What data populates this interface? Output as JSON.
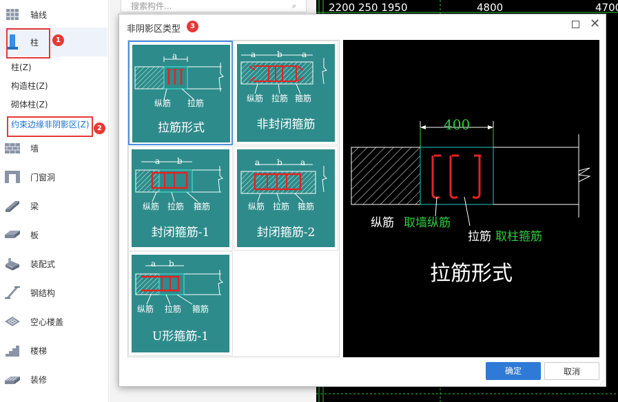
{
  "sidebar": {
    "categories": [
      {
        "label": "轴线",
        "icon": "axis-grid-icon"
      },
      {
        "label": "柱",
        "icon": "column-icon"
      },
      {
        "label": "墙",
        "icon": "wall-icon"
      },
      {
        "label": "门窗洞",
        "icon": "door-window-icon"
      },
      {
        "label": "梁",
        "icon": "beam-icon"
      },
      {
        "label": "板",
        "icon": "slab-icon"
      },
      {
        "label": "装配式",
        "icon": "prefab-icon"
      },
      {
        "label": "钢结构",
        "icon": "steel-structure-icon"
      },
      {
        "label": "空心楼盖",
        "icon": "hollow-floor-icon"
      },
      {
        "label": "楼梯",
        "icon": "stair-icon"
      },
      {
        "label": "装修",
        "icon": "decoration-icon"
      }
    ],
    "column_subitems": [
      "柱(Z)",
      "构造柱(Z)",
      "砌体柱(Z)",
      "约束边缘非阴影区(Z)"
    ],
    "badges": [
      "1",
      "2",
      "3"
    ]
  },
  "search": {
    "placeholder": "搜索构件..."
  },
  "cad_header": {
    "left": "2200  250 1950",
    "mid": "4800",
    "right": "4700"
  },
  "dialog": {
    "title": "非阴影区类型",
    "ok_label": "确定",
    "cancel_label": "取消",
    "types": [
      {
        "name": "拉筋形式",
        "labels": [
          "纵筋",
          "拉筋"
        ],
        "dims": [
          "a"
        ]
      },
      {
        "name": "非封闭箍筋",
        "labels": [
          "纵筋",
          "拉筋",
          "箍筋"
        ],
        "dims": [
          "a",
          "b",
          "a"
        ]
      },
      {
        "name": "封闭箍筋-1",
        "labels": [
          "纵筋",
          "拉筋",
          "箍筋"
        ],
        "dims": [
          "a",
          "b"
        ]
      },
      {
        "name": "封闭箍筋-2",
        "labels": [
          "纵筋",
          "拉筋",
          "箍筋"
        ],
        "dims": [
          "a",
          "b",
          "a"
        ]
      },
      {
        "name": "U形箍筋-1",
        "labels": [
          "纵筋",
          "拉筋",
          "箍筋"
        ],
        "dims": [
          "a",
          "b"
        ]
      }
    ],
    "selected_index": 0,
    "preview": {
      "dimension": "400",
      "label_long_bar": "纵筋",
      "label_long_bar_note": "取墙纵筋",
      "label_tie": "拉筋",
      "label_tie_note": "取柱箍筋",
      "title": "拉筋形式",
      "note_color": "#2ecc40",
      "dim_color": "#2ecc40"
    }
  }
}
